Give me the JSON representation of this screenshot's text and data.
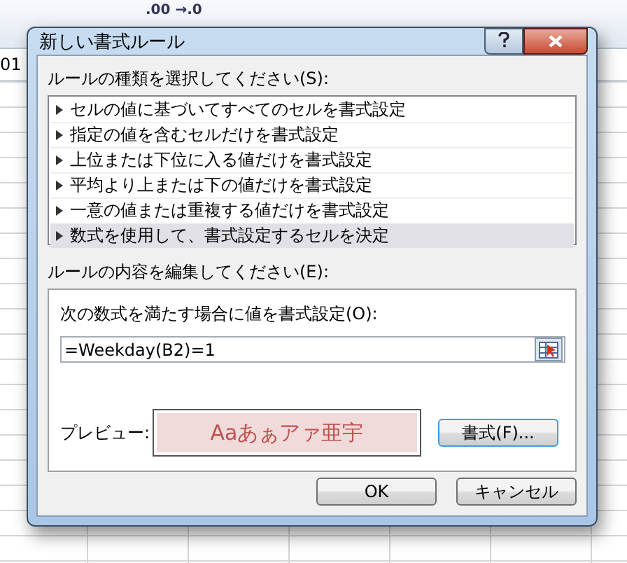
{
  "background": {
    "ribbon_text": ".00 →.0",
    "cell_text": "01"
  },
  "dialog": {
    "title": "新しい書式ルール",
    "rule_type_label": "ルールの種類を選択してください(S):",
    "rule_types": [
      {
        "label": "セルの値に基づいてすべてのセルを書式設定",
        "selected": false
      },
      {
        "label": "指定の値を含むセルだけを書式設定",
        "selected": false
      },
      {
        "label": "上位または下位に入る値だけを書式設定",
        "selected": false
      },
      {
        "label": "平均より上または下の値だけを書式設定",
        "selected": false
      },
      {
        "label": "一意の値または重複する値だけを書式設定",
        "selected": false
      },
      {
        "label": "数式を使用して、書式設定するセルを決定",
        "selected": true
      }
    ],
    "edit_label": "ルールの内容を編集してください(E):",
    "formula_label": "次の数式を満たす場合に値を書式設定(O):",
    "formula_value": "=Weekday(B2)=1",
    "preview_label": "プレビュー:",
    "preview_sample": "Aaあぁアァ亜宇",
    "format_button": "書式(F)...",
    "ok_button": "OK",
    "cancel_button": "キャンセル"
  }
}
